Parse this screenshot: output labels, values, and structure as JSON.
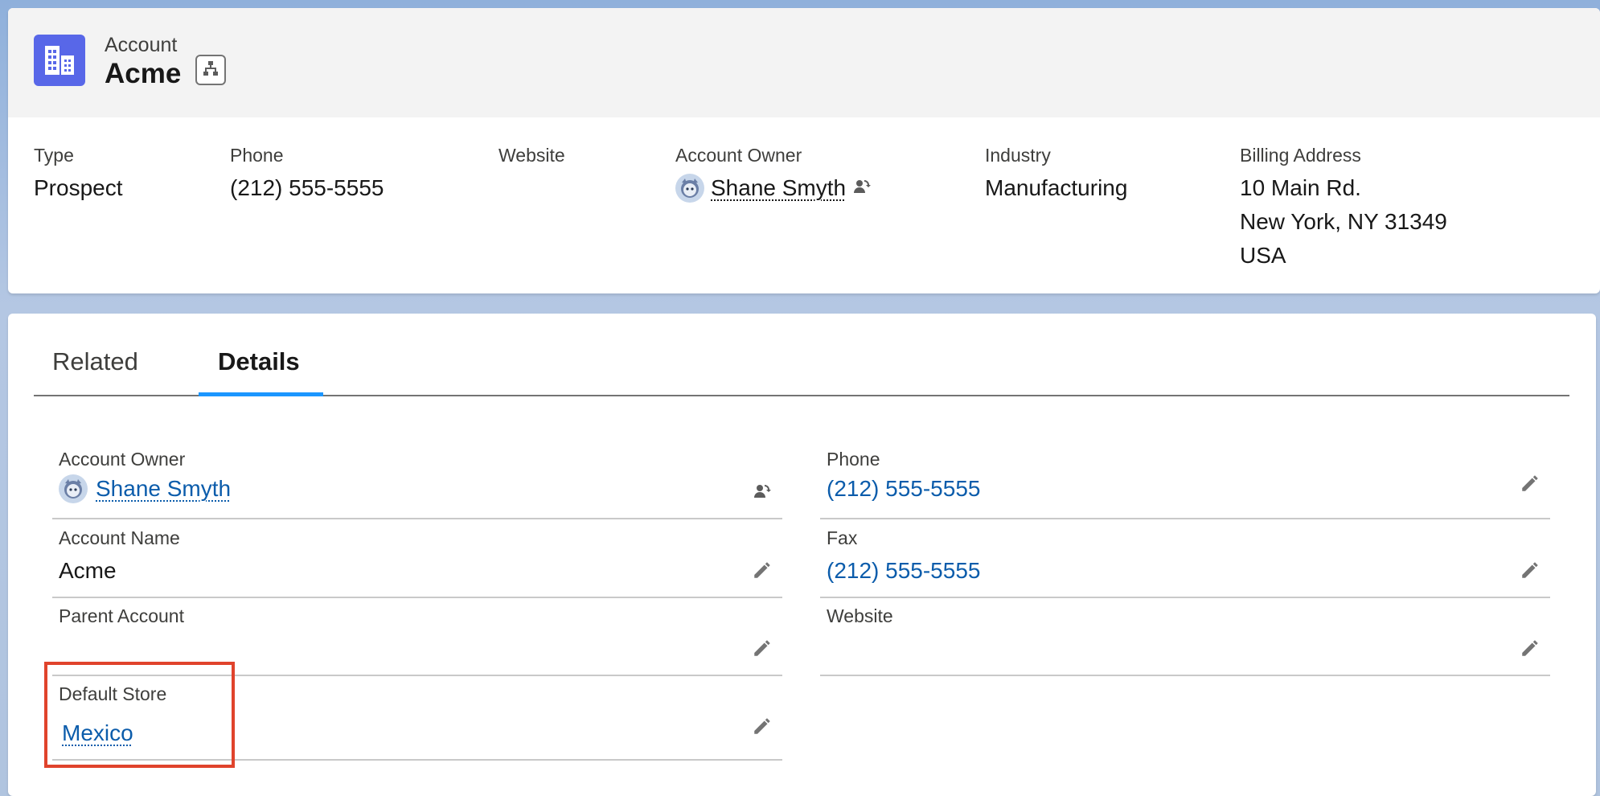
{
  "colors": {
    "brand_icon": "#5867e8",
    "link": "#0b5cab",
    "tab_active": "#1b96ff",
    "highlight": "#e0432c"
  },
  "icons": {
    "account": "account-building-icon",
    "hierarchy": "hierarchy-icon",
    "avatar": "user-avatar-icon",
    "change_owner": "change-owner-icon",
    "edit": "pencil-icon"
  },
  "header": {
    "object_label": "Account",
    "record_name": "Acme",
    "fields": {
      "type": {
        "label": "Type",
        "value": "Prospect"
      },
      "phone": {
        "label": "Phone",
        "value": "(212) 555-5555"
      },
      "website": {
        "label": "Website",
        "value": ""
      },
      "owner": {
        "label": "Account Owner",
        "value": "Shane Smyth"
      },
      "industry": {
        "label": "Industry",
        "value": "Manufacturing"
      },
      "billing": {
        "label": "Billing Address",
        "line1": "10 Main Rd.",
        "line2": "New York, NY 31349",
        "line3": "USA"
      }
    }
  },
  "tabs": {
    "related": "Related",
    "details": "Details",
    "active": "Details"
  },
  "details": {
    "left": {
      "owner": {
        "label": "Account Owner",
        "value": "Shane Smyth"
      },
      "name": {
        "label": "Account Name",
        "value": "Acme"
      },
      "parent": {
        "label": "Parent Account",
        "value": ""
      },
      "store": {
        "label": "Default Store",
        "value": "Mexico"
      }
    },
    "right": {
      "phone": {
        "label": "Phone",
        "value": "(212) 555-5555"
      },
      "fax": {
        "label": "Fax",
        "value": "(212) 555-5555"
      },
      "website": {
        "label": "Website",
        "value": ""
      }
    }
  }
}
